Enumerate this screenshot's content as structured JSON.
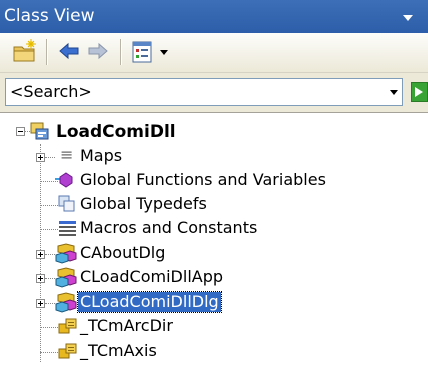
{
  "panel": {
    "title": "Class View"
  },
  "toolbar": {
    "new_folder_icon": "new-folder-icon",
    "back_icon": "back-arrow-icon",
    "forward_icon": "forward-arrow-icon",
    "settings_icon": "class-view-settings-icon"
  },
  "search": {
    "value": "<Search>"
  },
  "tree": {
    "root": {
      "label": "LoadComiDll",
      "expanded": true
    },
    "items": [
      {
        "label": "Maps",
        "icon": "maps-icon",
        "expandable": true
      },
      {
        "label": "Global Functions and Variables",
        "icon": "global-functions-icon",
        "expandable": false
      },
      {
        "label": "Global Typedefs",
        "icon": "typedef-icon",
        "expandable": false
      },
      {
        "label": "Macros and Constants",
        "icon": "macros-icon",
        "expandable": false
      },
      {
        "label": "CAboutDlg",
        "icon": "class-icon",
        "expandable": true
      },
      {
        "label": "CLoadComiDllApp",
        "icon": "class-icon",
        "expandable": true
      },
      {
        "label": "CLoadComiDllDlg",
        "icon": "class-icon",
        "expandable": true,
        "selected": true
      },
      {
        "label": "_TCmArcDir",
        "icon": "struct-icon",
        "expandable": false
      },
      {
        "label": "_TCmAxis",
        "icon": "struct-icon",
        "expandable": false
      }
    ]
  },
  "colors": {
    "titlebar": "#2c5ea9",
    "selection": "#316ac5",
    "toolbar": "#ece9d8"
  }
}
